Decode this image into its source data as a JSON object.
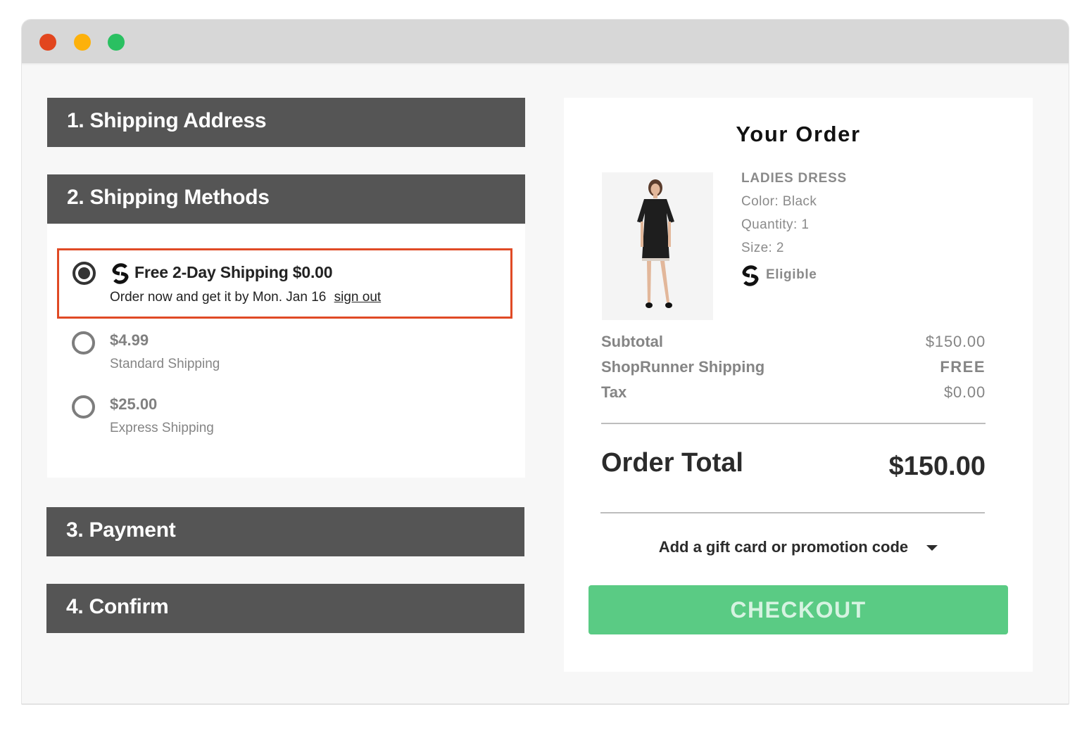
{
  "window": {
    "controls": [
      "close",
      "minimize",
      "maximize"
    ]
  },
  "steps": [
    {
      "label": "1. Shipping Address"
    },
    {
      "label": "2. Shipping Methods"
    },
    {
      "label": "3. Payment"
    },
    {
      "label": "4. Confirm"
    }
  ],
  "shipping_methods": {
    "selected": {
      "icon": "shoprunner-logo-icon",
      "title": "Free 2-Day Shipping $0.00",
      "subtitle": "Order now and get it by Mon. Jan 16",
      "link": "sign out",
      "checked": true
    },
    "options": [
      {
        "price": "$4.99",
        "description": "Standard Shipping",
        "checked": false
      },
      {
        "price": "$25.00",
        "description": "Express Shipping",
        "checked": false
      }
    ]
  },
  "order": {
    "title": "Your Order",
    "product": {
      "image": "product-photo-ladies-dress",
      "name": "LADIES DRESS",
      "color": "Color: Black",
      "quantity": "Quantity: 1",
      "size": "Size: 2",
      "eligible_icon": "shoprunner-logo-icon",
      "eligible": "Eligible"
    },
    "summary": [
      {
        "label": "Subtotal",
        "value": "$150.00"
      },
      {
        "label": "ShopRunner Shipping",
        "value": "FREE"
      },
      {
        "label": "Tax",
        "value": "$0.00"
      }
    ],
    "total_label": "Order Total",
    "total_value": "$150.00",
    "promo_label": "Add a gift card or promotion code",
    "checkout_label": "CHECKOUT"
  },
  "colors": {
    "step_bar": "#555555",
    "selected_border": "#e04a25",
    "checkout": "#5acb84",
    "checkout_text": "#d6f3e1"
  }
}
